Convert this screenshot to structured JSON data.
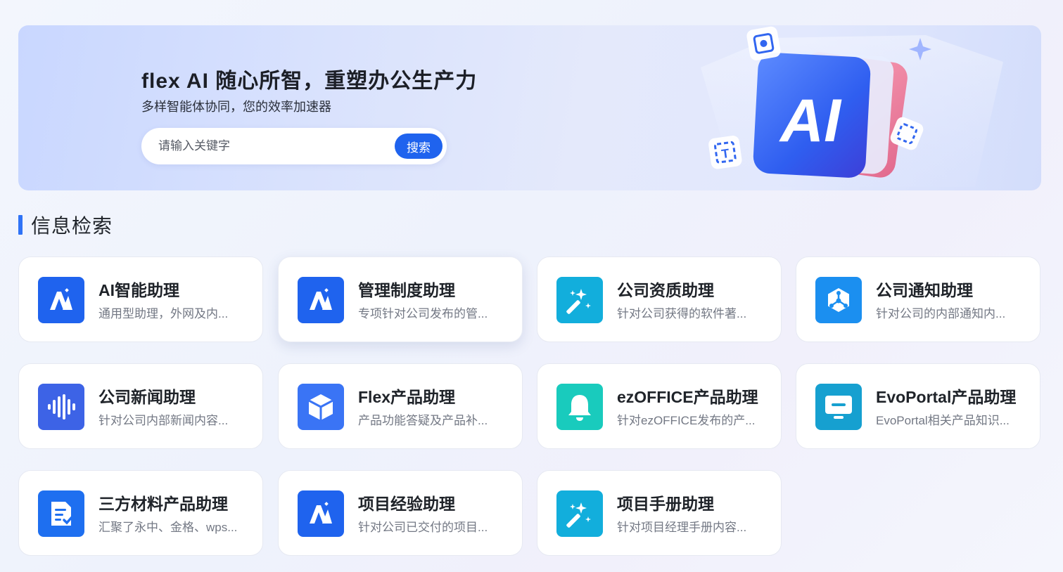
{
  "banner": {
    "title": "flex AI 随心所智，重塑办公生产力",
    "subtitle": "多样智能体协同，您的效率加速器",
    "search_placeholder": "请输入关键字",
    "search_button": "搜索",
    "hero_logo_text": "AI"
  },
  "section": {
    "title": "信息检索",
    "accent_color": "#2f73f6"
  },
  "cards": [
    {
      "title": "AI智能助理",
      "desc": "通用型助理，外网及内...",
      "icon": "ai-logo-icon",
      "color": "#1f63ee"
    },
    {
      "title": "管理制度助理",
      "desc": "专项针对公司发布的管...",
      "icon": "ai-logo-icon",
      "color": "#1f63ee"
    },
    {
      "title": "公司资质助理",
      "desc": "针对公司获得的软件著...",
      "icon": "magic-wand-icon",
      "color": "#12aedc"
    },
    {
      "title": "公司通知助理",
      "desc": "针对公司的内部通知内...",
      "icon": "hexagon-network-icon",
      "color": "#1b8ff0"
    },
    {
      "title": "公司新闻助理",
      "desc": "针对公司内部新闻内容...",
      "icon": "soundwave-icon",
      "color": "#3d63e6"
    },
    {
      "title": "Flex产品助理",
      "desc": "产品功能答疑及产品补...",
      "icon": "cube-icon",
      "color": "#3a74f5"
    },
    {
      "title": "ezOFFICE产品助理",
      "desc": "针对ezOFFICE发布的产...",
      "icon": "bell-icon",
      "color": "#19cbbd"
    },
    {
      "title": "EvoPortal产品助理",
      "desc": "EvoPortal相关产品知识...",
      "icon": "monitor-icon",
      "color": "#16a0d0"
    },
    {
      "title": "三方材料产品助理",
      "desc": "汇聚了永中、金格、wps...",
      "icon": "document-check-icon",
      "color": "#1e6ff0"
    },
    {
      "title": "项目经验助理",
      "desc": "针对公司已交付的项目...",
      "icon": "ai-logo-icon",
      "color": "#1f63ee"
    },
    {
      "title": "项目手册助理",
      "desc": "针对项目经理手册内容...",
      "icon": "magic-wand-icon",
      "color": "#12aedc"
    }
  ]
}
